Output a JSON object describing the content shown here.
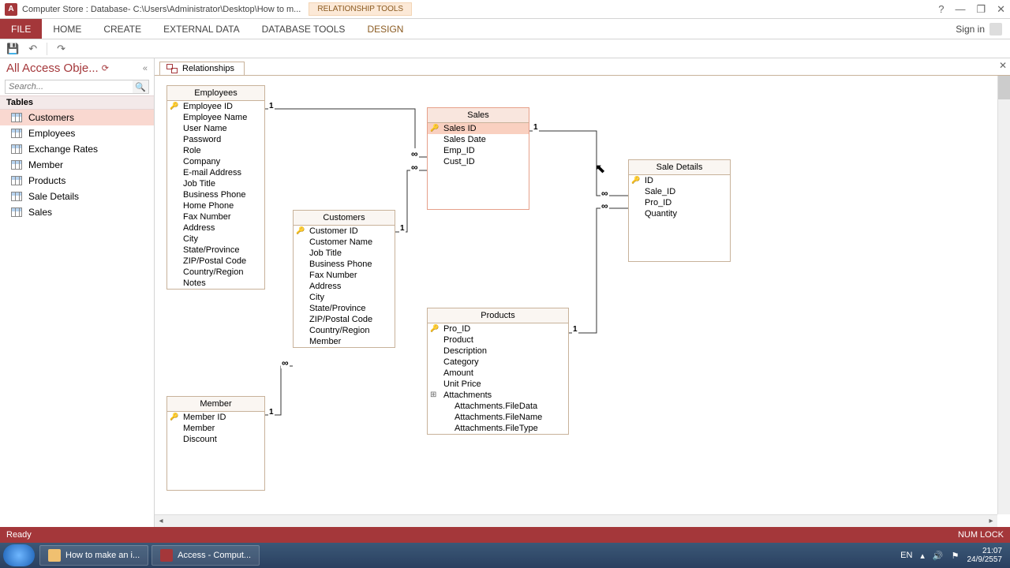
{
  "titlebar": {
    "app_letter": "A",
    "title": "Computer Store : Database- C:\\Users\\Administrator\\Desktop\\How to m...",
    "context_tools": "RELATIONSHIP TOOLS",
    "help": "?",
    "min": "—",
    "max": "❐",
    "close": "✕"
  },
  "ribbon": {
    "file": "FILE",
    "tabs": [
      "HOME",
      "CREATE",
      "EXTERNAL DATA",
      "DATABASE TOOLS"
    ],
    "context_tab": "DESIGN",
    "signin": "Sign in"
  },
  "qat": {
    "save": "💾",
    "undo": "↶",
    "redo": "↷"
  },
  "nav": {
    "header": "All Access Obje...",
    "search_placeholder": "Search...",
    "group": "Tables",
    "items": [
      "Customers",
      "Employees",
      "Exchange Rates",
      "Member",
      "Products",
      "Sale Details",
      "Sales"
    ],
    "selected": 0
  },
  "doc_tab": "Relationships",
  "tables": {
    "employees": {
      "title": "Employees",
      "fields": [
        "Employee ID",
        "Employee Name",
        "User Name",
        "Password",
        "Role",
        "Company",
        "E-mail Address",
        "Job Title",
        "Business Phone",
        "Home Phone",
        "Fax Number",
        "Address",
        "City",
        "State/Province",
        "ZIP/Postal Code",
        "Country/Region",
        "Notes"
      ],
      "pk": 0
    },
    "customers": {
      "title": "Customers",
      "fields": [
        "Customer ID",
        "Customer Name",
        "Job Title",
        "Business Phone",
        "Fax Number",
        "Address",
        "City",
        "State/Province",
        "ZIP/Postal Code",
        "Country/Region",
        "Member"
      ],
      "pk": 0
    },
    "member": {
      "title": "Member",
      "fields": [
        "Member ID",
        "Member",
        "Discount"
      ],
      "pk": 0
    },
    "sales": {
      "title": "Sales",
      "fields": [
        "Sales ID",
        "Sales Date",
        "Emp_ID",
        "Cust_ID"
      ],
      "pk": 0,
      "sel": 0
    },
    "products": {
      "title": "Products",
      "fields": [
        "Pro_ID",
        "Product",
        "Description",
        "Category",
        "Amount",
        "Unit Price",
        "Attachments",
        "Attachments.FileData",
        "Attachments.FileName",
        "Attachments.FileType"
      ],
      "pk": 0,
      "exp": 6,
      "sub_from": 7
    },
    "saledetails": {
      "title": "Sale Details",
      "fields": [
        "ID",
        "Sale_ID",
        "Pro_ID",
        "Quantity"
      ],
      "pk": 0
    }
  },
  "status": {
    "left": "Ready",
    "right": "NUM LOCK"
  },
  "taskbar": {
    "btn1": "How to make an i...",
    "btn2": "Access - Comput...",
    "lang": "EN",
    "time": "21:07",
    "date": "24/9/2557"
  }
}
